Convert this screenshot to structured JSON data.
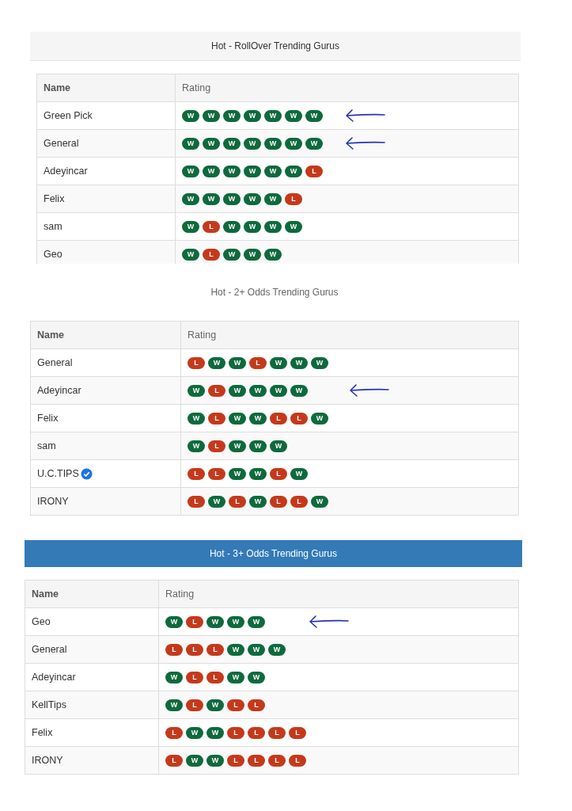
{
  "sections": [
    {
      "title": "Hot - RollOver Trending Gurus",
      "kind": "shaded",
      "columns": [
        "Name",
        "Rating"
      ],
      "rows": [
        {
          "name": "Green Pick",
          "verified": false,
          "marked": true,
          "results": [
            {
              "text": "W",
              "kind": "win"
            },
            {
              "text": "W",
              "kind": "win"
            },
            {
              "text": "W",
              "kind": "win"
            },
            {
              "text": "W",
              "kind": "win"
            },
            {
              "text": "W",
              "kind": "win"
            },
            {
              "text": "W",
              "kind": "win"
            },
            {
              "text": "W",
              "kind": "win"
            }
          ]
        },
        {
          "name": "General",
          "verified": false,
          "marked": true,
          "results": [
            {
              "text": "W",
              "kind": "win"
            },
            {
              "text": "W",
              "kind": "win"
            },
            {
              "text": "W",
              "kind": "win"
            },
            {
              "text": "W",
              "kind": "win"
            },
            {
              "text": "W",
              "kind": "win"
            },
            {
              "text": "W",
              "kind": "win"
            },
            {
              "text": "W",
              "kind": "win"
            }
          ]
        },
        {
          "name": "Adeyincar",
          "verified": false,
          "marked": false,
          "results": [
            {
              "text": "W",
              "kind": "win"
            },
            {
              "text": "W",
              "kind": "win"
            },
            {
              "text": "W",
              "kind": "win"
            },
            {
              "text": "W",
              "kind": "win"
            },
            {
              "text": "W",
              "kind": "win"
            },
            {
              "text": "W",
              "kind": "win"
            },
            {
              "text": "L",
              "kind": "loss"
            }
          ]
        },
        {
          "name": "Felix",
          "verified": false,
          "marked": false,
          "results": [
            {
              "text": "W",
              "kind": "win"
            },
            {
              "text": "W",
              "kind": "win"
            },
            {
              "text": "W",
              "kind": "win"
            },
            {
              "text": "W",
              "kind": "win"
            },
            {
              "text": "W",
              "kind": "win"
            },
            {
              "text": "L",
              "kind": "loss"
            }
          ]
        },
        {
          "name": "sam",
          "verified": false,
          "marked": false,
          "results": [
            {
              "text": "W",
              "kind": "win"
            },
            {
              "text": "L",
              "kind": "loss"
            },
            {
              "text": "W",
              "kind": "win"
            },
            {
              "text": "W",
              "kind": "win"
            },
            {
              "text": "W",
              "kind": "win"
            },
            {
              "text": "W",
              "kind": "win"
            }
          ]
        },
        {
          "name": "Geo",
          "verified": false,
          "marked": false,
          "results": [
            {
              "text": "W",
              "kind": "win"
            },
            {
              "text": "L",
              "kind": "loss"
            },
            {
              "text": "W",
              "kind": "win"
            },
            {
              "text": "W",
              "kind": "win"
            },
            {
              "text": "W",
              "kind": "win"
            }
          ]
        }
      ]
    },
    {
      "title": "Hot - 2+ Odds Trending Gurus",
      "kind": "plain",
      "columns": [
        "Name",
        "Rating"
      ],
      "rows": [
        {
          "name": "General",
          "verified": false,
          "marked": false,
          "results": [
            {
              "text": "L",
              "kind": "loss"
            },
            {
              "text": "W",
              "kind": "win"
            },
            {
              "text": "W",
              "kind": "win"
            },
            {
              "text": "L",
              "kind": "loss"
            },
            {
              "text": "W",
              "kind": "win"
            },
            {
              "text": "W",
              "kind": "win"
            },
            {
              "text": "W",
              "kind": "win"
            }
          ]
        },
        {
          "name": "Adeyincar",
          "verified": false,
          "marked": true,
          "results": [
            {
              "text": "W",
              "kind": "win"
            },
            {
              "text": "L",
              "kind": "loss"
            },
            {
              "text": "W",
              "kind": "win"
            },
            {
              "text": "W",
              "kind": "win"
            },
            {
              "text": "W",
              "kind": "win"
            },
            {
              "text": "W",
              "kind": "win"
            }
          ]
        },
        {
          "name": "Felix",
          "verified": false,
          "marked": false,
          "results": [
            {
              "text": "W",
              "kind": "win"
            },
            {
              "text": "L",
              "kind": "loss"
            },
            {
              "text": "W",
              "kind": "win"
            },
            {
              "text": "W",
              "kind": "win"
            },
            {
              "text": "L",
              "kind": "loss"
            },
            {
              "text": "L",
              "kind": "loss"
            },
            {
              "text": "W",
              "kind": "win"
            }
          ]
        },
        {
          "name": "sam",
          "verified": false,
          "marked": false,
          "results": [
            {
              "text": "W",
              "kind": "win"
            },
            {
              "text": "L",
              "kind": "loss"
            },
            {
              "text": "W",
              "kind": "win"
            },
            {
              "text": "W",
              "kind": "win"
            },
            {
              "text": "W",
              "kind": "win"
            }
          ]
        },
        {
          "name": "U.C.TIPS",
          "verified": true,
          "marked": false,
          "results": [
            {
              "text": "L",
              "kind": "loss"
            },
            {
              "text": "L",
              "kind": "loss"
            },
            {
              "text": "W",
              "kind": "win"
            },
            {
              "text": "W",
              "kind": "win"
            },
            {
              "text": "L",
              "kind": "loss"
            },
            {
              "text": "W",
              "kind": "win"
            }
          ]
        },
        {
          "name": "IRONY",
          "verified": false,
          "marked": false,
          "results": [
            {
              "text": "L",
              "kind": "loss"
            },
            {
              "text": "W",
              "kind": "win"
            },
            {
              "text": "L",
              "kind": "loss"
            },
            {
              "text": "W",
              "kind": "win"
            },
            {
              "text": "L",
              "kind": "loss"
            },
            {
              "text": "L",
              "kind": "loss"
            },
            {
              "text": "W",
              "kind": "win"
            }
          ]
        }
      ]
    },
    {
      "title": "Hot - 3+ Odds Trending Gurus",
      "kind": "highlighted",
      "columns": [
        "Name",
        "Rating"
      ],
      "rows": [
        {
          "name": "Geo",
          "verified": false,
          "marked": true,
          "results": [
            {
              "text": "W",
              "kind": "win"
            },
            {
              "text": "L",
              "kind": "loss"
            },
            {
              "text": "W",
              "kind": "win"
            },
            {
              "text": "W",
              "kind": "win"
            },
            {
              "text": "W",
              "kind": "win"
            }
          ]
        },
        {
          "name": "General",
          "verified": false,
          "marked": false,
          "results": [
            {
              "text": "L",
              "kind": "loss"
            },
            {
              "text": "L",
              "kind": "loss"
            },
            {
              "text": "L",
              "kind": "loss"
            },
            {
              "text": "W",
              "kind": "win"
            },
            {
              "text": "W",
              "kind": "win"
            },
            {
              "text": "W",
              "kind": "win"
            }
          ]
        },
        {
          "name": "Adeyincar",
          "verified": false,
          "marked": false,
          "results": [
            {
              "text": "W",
              "kind": "win"
            },
            {
              "text": "L",
              "kind": "loss"
            },
            {
              "text": "L",
              "kind": "loss"
            },
            {
              "text": "W",
              "kind": "win"
            },
            {
              "text": "W",
              "kind": "win"
            }
          ]
        },
        {
          "name": "KellTips",
          "verified": false,
          "marked": false,
          "results": [
            {
              "text": "W",
              "kind": "win"
            },
            {
              "text": "L",
              "kind": "loss"
            },
            {
              "text": "W",
              "kind": "win"
            },
            {
              "text": "L",
              "kind": "loss"
            },
            {
              "text": "L",
              "kind": "loss"
            }
          ]
        },
        {
          "name": "Felix",
          "verified": false,
          "marked": false,
          "results": [
            {
              "text": "L",
              "kind": "loss"
            },
            {
              "text": "W",
              "kind": "win"
            },
            {
              "text": "W",
              "kind": "win"
            },
            {
              "text": "L",
              "kind": "loss"
            },
            {
              "text": "L",
              "kind": "loss"
            },
            {
              "text": "L",
              "kind": "loss"
            },
            {
              "text": "L",
              "kind": "loss"
            }
          ]
        },
        {
          "name": "IRONY",
          "verified": false,
          "marked": false,
          "results": [
            {
              "text": "L",
              "kind": "loss"
            },
            {
              "text": "W",
              "kind": "win"
            },
            {
              "text": "W",
              "kind": "win"
            },
            {
              "text": "L",
              "kind": "loss"
            },
            {
              "text": "L",
              "kind": "loss"
            },
            {
              "text": "L",
              "kind": "loss"
            },
            {
              "text": "L",
              "kind": "loss"
            }
          ]
        }
      ]
    }
  ]
}
